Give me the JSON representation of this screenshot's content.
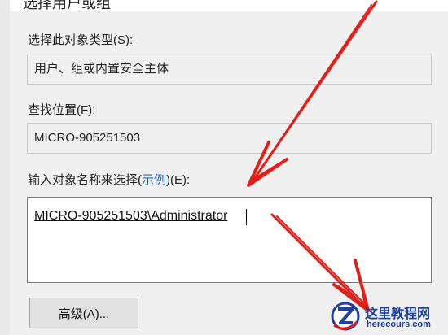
{
  "dialog": {
    "title": "选择用户或组",
    "object_type": {
      "label": "选择此对象类型(S):",
      "value": "用户、组或内置安全主体"
    },
    "location": {
      "label": "查找位置(F):",
      "value": "MICRO-905251503"
    },
    "object_names": {
      "label_prefix": "输入对象名称来选择(",
      "example_link": "示例",
      "label_suffix": ")(E):",
      "value": "MICRO-905251503\\Administrator"
    },
    "advanced_button": "高级(A)..."
  },
  "annotation": {
    "arrow_color": "#e0201a"
  },
  "watermark": {
    "title": "这里教程网",
    "url": "herecours.com"
  }
}
